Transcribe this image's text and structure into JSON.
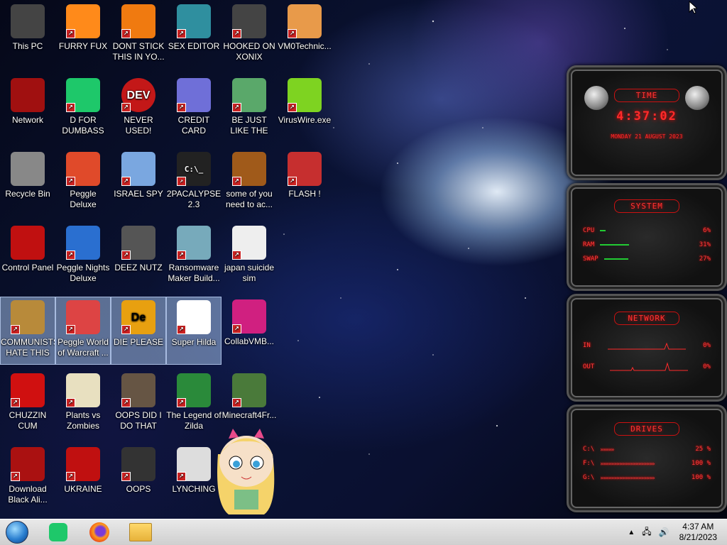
{
  "desktop": {
    "icons": [
      {
        "label": "This PC"
      },
      {
        "label": "FURRY FUX"
      },
      {
        "label": "DONT STICK THIS IN YO..."
      },
      {
        "label": "SEX EDITOR"
      },
      {
        "label": "HOOKED ON XONIX"
      },
      {
        "label": "VM0Technic..."
      },
      {
        "label": "Network"
      },
      {
        "label": "D FOR DUMBASS"
      },
      {
        "label": "NEVER USED!"
      },
      {
        "label": "CREDIT CARD CHECKER"
      },
      {
        "label": "BE JUST LIKE THE DUDE!"
      },
      {
        "label": "VirusWire.exe"
      },
      {
        "label": "Recycle Bin"
      },
      {
        "label": "Peggle Deluxe"
      },
      {
        "label": "ISRAEL SPY"
      },
      {
        "label": "2PACALYPSE 2.3"
      },
      {
        "label": "some of you need to ac..."
      },
      {
        "label": "FLASH !"
      },
      {
        "label": "Control Panel"
      },
      {
        "label": "Peggle Nights Deluxe"
      },
      {
        "label": "DEEZ NUTZ"
      },
      {
        "label": "Ransomware Maker Build..."
      },
      {
        "label": "japan suicide sim"
      },
      {
        "label": "COMMUNISTS HATE THIS G..."
      },
      {
        "label": "Peggle World of Warcraft ..."
      },
      {
        "label": "DIE PLEASE"
      },
      {
        "label": "Super Hilda"
      },
      {
        "label": "CollabVMB..."
      },
      {
        "label": "CHUZZIN CUM"
      },
      {
        "label": "Plants vs Zombies"
      },
      {
        "label": "OOPS DID I DO THAT"
      },
      {
        "label": "The Legend of Zilda"
      },
      {
        "label": "Minecraft4Fr..."
      },
      {
        "label": "Download Black Ali..."
      },
      {
        "label": "UKRAINE"
      },
      {
        "label": "OOPS"
      },
      {
        "label": "LYNCHING"
      }
    ],
    "dev_icon_text": "DEV",
    "de_icon_text": "De",
    "cmd_icon_text": "C:\\_"
  },
  "widget": {
    "time_title": "TIME",
    "time": "4:37:02",
    "date": "MONDAY 21 AUGUST 2023",
    "system_title": "SYSTEM",
    "cpu_label": "CPU",
    "cpu_value": "6%",
    "cpu_fraction": 0.06,
    "ram_label": "RAM",
    "ram_value": "31%",
    "ram_fraction": 0.31,
    "swap_label": "SWAP",
    "swap_value": "27%",
    "swap_fraction": 0.27,
    "network_title": "NETWORK",
    "in_label": "IN",
    "in_value": "0%",
    "out_label": "OUT",
    "out_value": "0%",
    "drives_title": "DRIVES",
    "drives": [
      {
        "label": "C:\\",
        "value": "25 %",
        "fraction": 0.25
      },
      {
        "label": "F:\\",
        "value": "100 %",
        "fraction": 1.0
      },
      {
        "label": "G:\\",
        "value": "100 %",
        "fraction": 1.0
      }
    ]
  },
  "taskbar": {
    "time": "4:37 AM",
    "date": "8/21/2023"
  },
  "colors": {
    "widget_red": "#ff2a2a",
    "bar_green": "#22cc33",
    "taskbar": "#dcdcdc"
  }
}
